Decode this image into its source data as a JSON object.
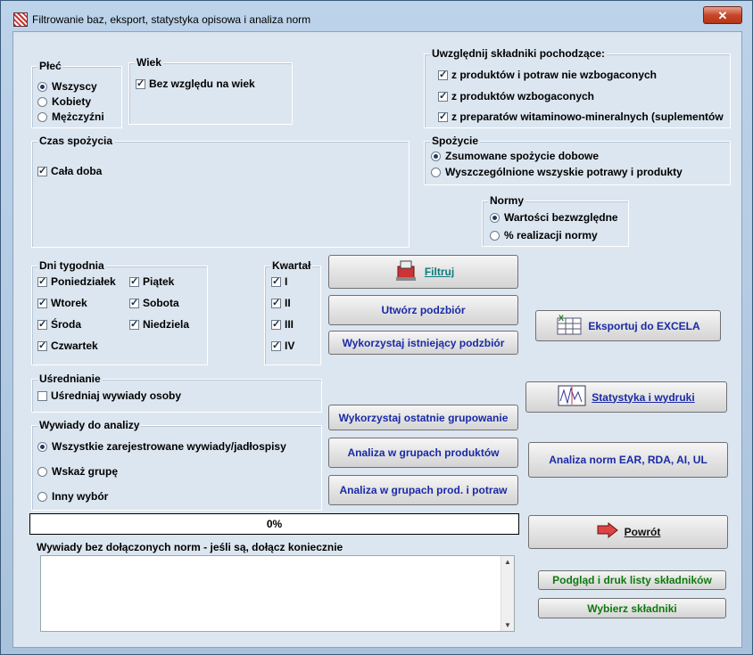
{
  "window": {
    "title": "Filtrowanie baz, eksport, statystyka opisowa i analiza norm",
    "close_label": "✕"
  },
  "plec": {
    "legend": "Płeć",
    "options": [
      "Wszyscy",
      "Kobiety",
      "Mężczyźni"
    ],
    "selected": 0
  },
  "wiek": {
    "legend": "Wiek",
    "checkbox": "Bez względu na wiek",
    "checked": true
  },
  "skladniki": {
    "legend": "Uwzględnij składniki pochodzące:",
    "items": [
      "z produktów i potraw nie wzbogaconych",
      "z produktów wzbogaconych",
      "z preparatów witaminowo-mineralnych (suplementów"
    ],
    "checked": [
      true,
      true,
      true
    ]
  },
  "czas": {
    "legend": "Czas spożycia",
    "checkbox": "Cała doba",
    "checked": true
  },
  "spozycie": {
    "legend": "Spożycie",
    "options": [
      "Zsumowane spożycie dobowe",
      "Wyszczególnione wszyskie potrawy i produkty"
    ],
    "selected": 0
  },
  "normy": {
    "legend": "Normy",
    "options": [
      "Wartości bezwzględne",
      "% realizacji normy"
    ],
    "selected": 0
  },
  "dni": {
    "legend": "Dni tygodnia",
    "items": [
      "Poniedziałek",
      "Wtorek",
      "Środa",
      "Czwartek",
      "Piątek",
      "Sobota",
      "Niedziela"
    ]
  },
  "kwartal": {
    "legend": "Kwartał",
    "items": [
      "I",
      "II",
      "III",
      "IV"
    ]
  },
  "usrednianie": {
    "legend": "Uśrednianie",
    "checkbox": "Uśredniaj wywiady osoby",
    "checked": false
  },
  "wywiady": {
    "legend": "Wywiady do analizy",
    "options": [
      "Wszystkie zarejestrowane wywiady/jadłospisy",
      "Wskaż grupę",
      "Inny wybór"
    ],
    "selected": 0
  },
  "buttons": {
    "filtruj": "Filtruj",
    "utworz": "Utwórz podzbiór",
    "wykorzystaj": "Wykorzystaj istniejący podzbiór",
    "eksport": "Eksportuj do EXCELA",
    "statystyka": "Statystyka i wydruki",
    "ostatnie": "Wykorzystaj ostatnie grupowanie",
    "grupy_prod": "Analiza w grupach produktów",
    "analiza_norm": "Analiza norm EAR, RDA, AI, UL",
    "grupy_potraw": "Analiza w grupach prod. i potraw",
    "powrot": "Powrót",
    "podglad": "Podgląd i druk listy składników",
    "wybierz": "Wybierz składniki"
  },
  "progress": {
    "value": "0%"
  },
  "memo": {
    "legend": "Wywiady bez dołączonych norm - jeśli są, dołącz koniecznie",
    "text": ""
  }
}
